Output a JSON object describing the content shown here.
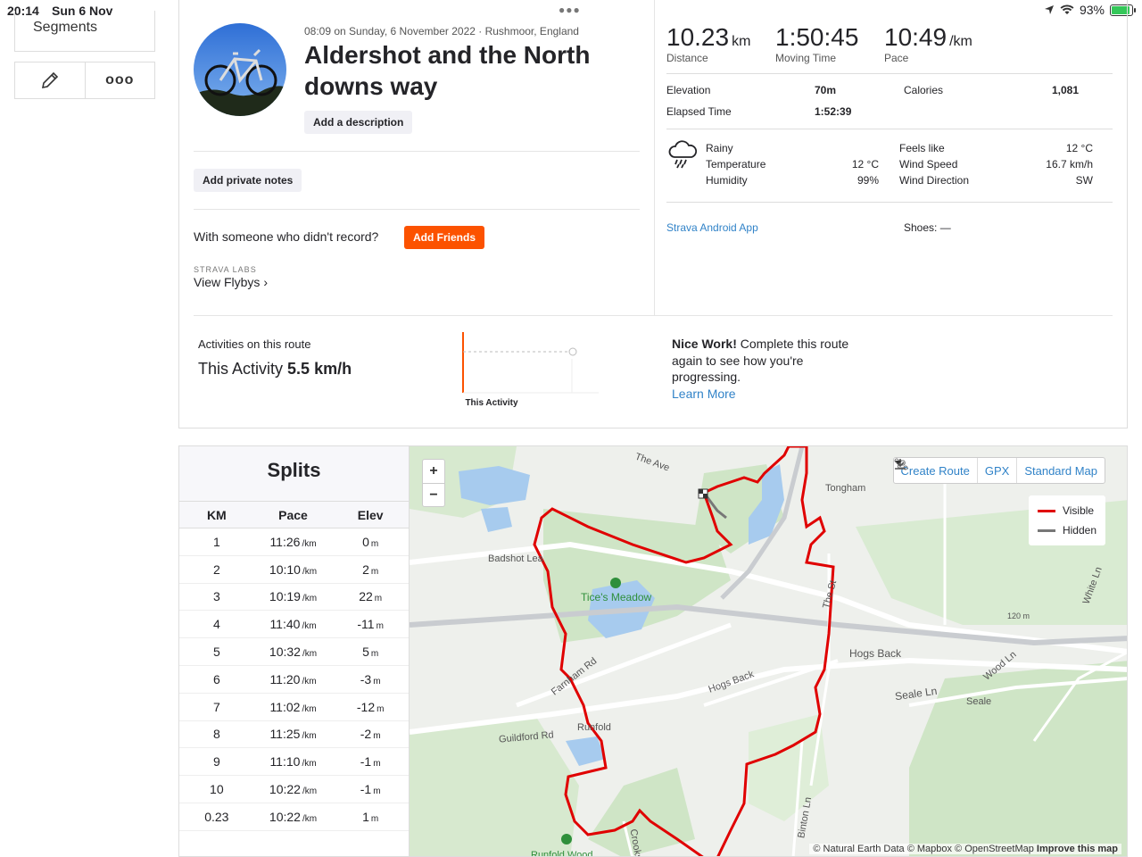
{
  "status_bar": {
    "time": "20:14",
    "date": "Sun 6 Nov",
    "battery": "93%"
  },
  "nav": {
    "segments": "Segments",
    "more": "ooo"
  },
  "activity": {
    "meta": "08:09 on Sunday, 6 November 2022 · Rushmoor, England",
    "title": "Aldershot and the North downs way",
    "add_description": "Add a description",
    "add_private_notes": "Add private notes",
    "with_someone": "With someone who didn't record?",
    "add_friends": "Add Friends",
    "labs_label": "STRAVA LABS",
    "view_flybys": "View Flybys ›"
  },
  "stats": {
    "distance": {
      "value": "10.23",
      "unit": "km",
      "label": "Distance"
    },
    "moving_time": {
      "value": "1:50:45",
      "label": "Moving Time"
    },
    "pace": {
      "value": "10:49",
      "unit": "/km",
      "label": "Pace"
    },
    "elevation_label": "Elevation",
    "elevation": "70m",
    "calories_label": "Calories",
    "calories": "1,081",
    "elapsed_label": "Elapsed Time",
    "elapsed": "1:52:39"
  },
  "weather": {
    "condition": "Rainy",
    "temperature_label": "Temperature",
    "temperature": "12 °C",
    "humidity_label": "Humidity",
    "humidity": "99%",
    "feels_like_label": "Feels like",
    "feels_like": "12 °C",
    "wind_speed_label": "Wind Speed",
    "wind_speed": "16.7 km/h",
    "wind_direction_label": "Wind Direction",
    "wind_direction": "SW",
    "icon": "rain-cloud-icon"
  },
  "device": {
    "app": "Strava Android App",
    "shoes": "Shoes: —"
  },
  "route": {
    "label": "Activities on this route",
    "this_activity": "This Activity",
    "speed": "5.5 km/h",
    "chart_label": "This Activity",
    "nice_bold": "Nice Work!",
    "nice_text": " Complete this route again to see how you're progressing.",
    "learn_more": "Learn More"
  },
  "splits": {
    "title": "Splits",
    "headers": [
      "KM",
      "Pace",
      "Elev"
    ],
    "pace_unit": "/km",
    "elev_unit": "m",
    "rows": [
      {
        "km": "1",
        "pace": "11:26",
        "elev": "0"
      },
      {
        "km": "2",
        "pace": "10:10",
        "elev": "2"
      },
      {
        "km": "3",
        "pace": "10:19",
        "elev": "22"
      },
      {
        "km": "4",
        "pace": "11:40",
        "elev": "-11"
      },
      {
        "km": "5",
        "pace": "10:32",
        "elev": "5"
      },
      {
        "km": "6",
        "pace": "11:20",
        "elev": "-3"
      },
      {
        "km": "7",
        "pace": "11:02",
        "elev": "-12"
      },
      {
        "km": "8",
        "pace": "11:25",
        "elev": "-2"
      },
      {
        "km": "9",
        "pace": "11:10",
        "elev": "-1"
      },
      {
        "km": "10",
        "pace": "10:22",
        "elev": "-1"
      },
      {
        "km": "0.23",
        "pace": "10:22",
        "elev": "1"
      }
    ]
  },
  "map": {
    "zoom_in": "+",
    "zoom_out": "−",
    "create_route": "Create Route",
    "gpx": "GPX",
    "standard_map": "Standard Map",
    "legend_visible": "Visible",
    "legend_hidden": "Hidden",
    "labels": [
      "Badshot Lea",
      "Tice's Meadow",
      "Tongham",
      "The Ave",
      "Hogs Back",
      "Hogs Back",
      "Farnham Rd",
      "Runfold",
      "Guildford Rd",
      "Seale Ln",
      "Seale",
      "Wood Ln",
      "White Ln",
      "Binton Ln",
      "Runfold Wood",
      "The St",
      "120 m",
      "Crooks"
    ],
    "attribution_plain": "© Natural Earth Data © Mapbox © OpenStreetMap",
    "attribution_bold": "Improve this map",
    "colors": {
      "visible": "#e00000",
      "hidden": "#777777"
    }
  }
}
